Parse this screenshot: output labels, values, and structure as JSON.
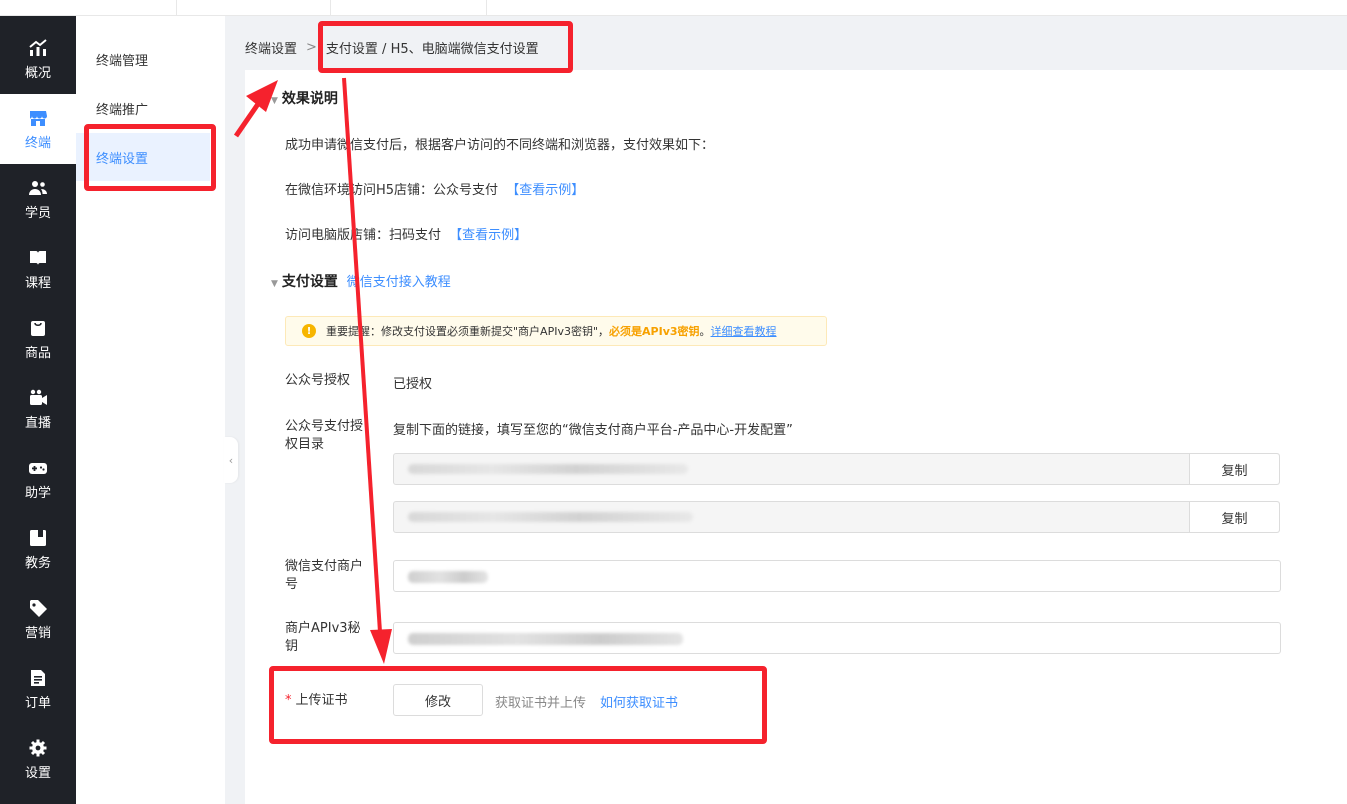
{
  "nav": {
    "items": [
      {
        "label": "概况",
        "icon": "chart-trend-icon",
        "active": false
      },
      {
        "label": "终端",
        "icon": "store-icon",
        "active": true
      },
      {
        "label": "学员",
        "icon": "users-icon",
        "active": false
      },
      {
        "label": "课程",
        "icon": "book-icon",
        "active": false
      },
      {
        "label": "商品",
        "icon": "bag-icon",
        "active": false
      },
      {
        "label": "直播",
        "icon": "video-camera-icon",
        "active": false
      },
      {
        "label": "助学",
        "icon": "gamepad-icon",
        "active": false
      },
      {
        "label": "教务",
        "icon": "calendar-book-icon",
        "active": false
      },
      {
        "label": "营销",
        "icon": "tag-icon",
        "active": false
      },
      {
        "label": "订单",
        "icon": "document-icon",
        "active": false
      },
      {
        "label": "设置",
        "icon": "gear-icon",
        "active": false
      }
    ]
  },
  "subnav": {
    "items": [
      {
        "label": "终端管理",
        "active": false
      },
      {
        "label": "终端推广",
        "active": false
      },
      {
        "label": "终端设置",
        "active": true
      }
    ]
  },
  "breadcrumb": {
    "root": "终端设置",
    "separator": ">",
    "current": "支付设置 / H5、电脑端微信支付设置"
  },
  "effect": {
    "title": "效果说明",
    "intro": "成功申请微信支付后，根据客户访问的不同终端和浏览器，支付效果如下：",
    "line1_text": "在微信环境访问H5店铺：公众号支付",
    "line1_link": "【查看示例】",
    "line2_text": "访问电脑版店铺：扫码支付",
    "line2_link": "【查看示例】"
  },
  "payment": {
    "title": "支付设置",
    "tutorial_link": "微信支付接入教程",
    "notice_prefix": "重要提醒：修改支付设置必须重新提交\"商户APIv3密钥\"，",
    "notice_strong": "必须是APIv3密钥",
    "notice_sep": "。",
    "notice_link": "详细查看教程",
    "auth_label": "公众号授权",
    "auth_value": "已授权",
    "dir_label": "公众号支付授权目录",
    "dir_hint": "复制下面的链接，填写至您的“微信支付商户平台-产品中心-开发配置”",
    "copy_label": "复制",
    "merchant_label": "微信支付商户号",
    "apikey_label": "商户APIv3秘钥",
    "cert_required": "*",
    "cert_label": "上传证书",
    "cert_button": "修改",
    "cert_hint": "获取证书并上传",
    "cert_link": "如何获取证书"
  },
  "colors": {
    "nav_bg": "#1f2228",
    "accent": "#3d8eff",
    "annotation": "#f5222d",
    "notice_strong": "#f7a100"
  }
}
